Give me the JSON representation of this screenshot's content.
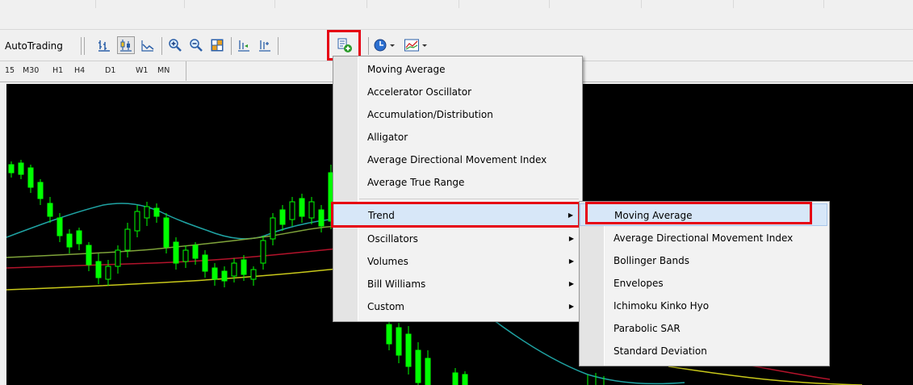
{
  "toolbar": {
    "autotrading_label": "AutoTrading"
  },
  "timeframes": [
    "15",
    "M30",
    "H1",
    "H4",
    "D1",
    "W1",
    "MN"
  ],
  "indicators_menu": {
    "items": [
      "Moving Average",
      "Accelerator Oscillator",
      "Accumulation/Distribution",
      "Alligator",
      "Average Directional Movement Index",
      "Average True Range"
    ],
    "categories": [
      "Trend",
      "Oscillators",
      "Volumes",
      "Bill Williams",
      "Custom"
    ]
  },
  "trend_submenu": {
    "items": [
      "Moving Average",
      "Average Directional Movement Index",
      "Bollinger Bands",
      "Envelopes",
      "Ichimoku Kinko Hyo",
      "Parabolic SAR",
      "Standard Deviation"
    ]
  },
  "colors": {
    "highlight_box": "#e60012",
    "menu_hover": "#d7e7f8",
    "chart_background": "#000000",
    "candle": "#00ff00",
    "ma_teal": "#1fa3a3",
    "ma_red": "#b3132b",
    "ma_yellow": "#c9c91a",
    "ma_olive": "#7fa33a"
  },
  "icons": [
    "bar-chart-icon",
    "candlestick-chart-icon",
    "line-chart-icon",
    "zoom-in-icon",
    "zoom-out-icon",
    "tile-windows-icon",
    "chart-shift-icon",
    "auto-scroll-icon",
    "indicators-list-icon",
    "period-clock-icon",
    "templates-icon"
  ]
}
